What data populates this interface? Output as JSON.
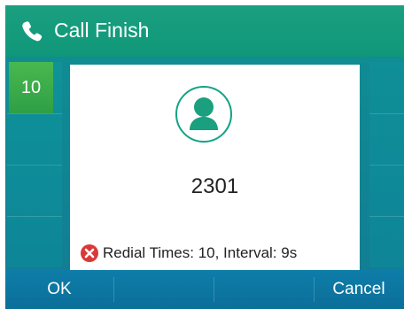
{
  "header": {
    "title": "Call Finish",
    "icon": "phone-icon"
  },
  "line_key": {
    "label": "10"
  },
  "dialog": {
    "avatar_icon": "contact-avatar-icon",
    "number": "2301",
    "status_icon": "error-circle-icon",
    "status_text": "Redial Times: 10, Interval: 9s"
  },
  "softkeys": {
    "left_label": "OK",
    "right_label": "Cancel"
  }
}
